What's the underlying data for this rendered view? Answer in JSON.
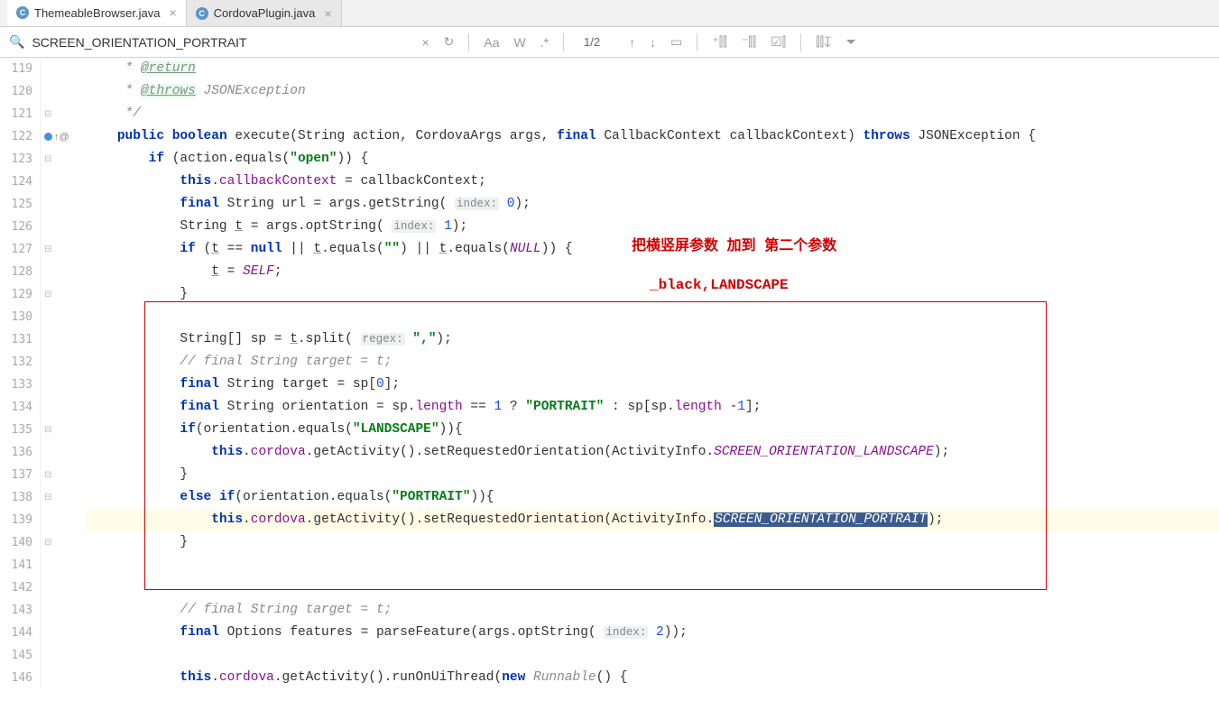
{
  "tabs": {
    "t0": {
      "label": "ThemeableBrowser.java"
    },
    "t1": {
      "label": "CordovaPlugin.java"
    }
  },
  "find": {
    "query": "SCREEN_ORIENTATION_PORTRAIT",
    "matchCount": "1/2",
    "caseLabel": "Aa",
    "wordLabel": "W",
    "regexLabel": ".*"
  },
  "annotations": {
    "a1": "把横竖屏参数 加到 第二个参数",
    "a2": "_black,LANDSCAPE"
  },
  "lines": {
    "n119": "119",
    "n120": "120",
    "n121": "121",
    "n122": "122",
    "n123": "123",
    "n124": "124",
    "n125": "125",
    "n126": "126",
    "n127": "127",
    "n128": "128",
    "n129": "129",
    "n130": "130",
    "n131": "131",
    "n132": "132",
    "n133": "133",
    "n134": "134",
    "n135": "135",
    "n136": "136",
    "n137": "137",
    "n138": "138",
    "n139": "139",
    "n140": "140",
    "n141": "141",
    "n142": "142",
    "n143": "143",
    "n144": "144",
    "n145": "145",
    "n146": "146"
  },
  "code": {
    "c119_pre": "     * ",
    "c119_tag": "@return",
    "c120_pre": "     * ",
    "c120_tag": "@throws",
    "c120_rest": " JSONException",
    "c121": "     */",
    "c122_1": "    ",
    "c122_k1": "public",
    "c122_2": " ",
    "c122_k2": "boolean",
    "c122_3": " execute(String action, CordovaArgs args, ",
    "c122_k3": "final",
    "c122_4": " CallbackContext callbackContext) ",
    "c122_k4": "throws",
    "c122_5": " JSONException {",
    "c123_1": "        ",
    "c123_k1": "if",
    "c123_2": " (action.equals(",
    "c123_s1": "\"open\"",
    "c123_3": ")) {",
    "c124_1": "            ",
    "c124_k1": "this",
    "c124_2": ".",
    "c124_f1": "callbackContext",
    "c124_3": " = callbackContext;",
    "c125_1": "            ",
    "c125_k1": "final",
    "c125_2": " String url = args.getString( ",
    "c125_h": "index:",
    "c125_3": " ",
    "c125_n": "0",
    "c125_4": ");",
    "c126_1": "            String ",
    "c126_u": "t",
    "c126_2": " = args.optString( ",
    "c126_h": "index:",
    "c126_3": " ",
    "c126_n": "1",
    "c126_4": ");",
    "c127_1": "            ",
    "c127_k1": "if",
    "c127_2": " (",
    "c127_u1": "t",
    "c127_3": " == ",
    "c127_k2": "null",
    "c127_4": " || ",
    "c127_u2": "t",
    "c127_5": ".equals(",
    "c127_s1": "\"\"",
    "c127_6": ") || ",
    "c127_u3": "t",
    "c127_7": ".equals(",
    "c127_c1": "NULL",
    "c127_8": ")) {",
    "c128_1": "                ",
    "c128_u": "t",
    "c128_2": " = ",
    "c128_c": "SELF",
    "c128_3": ";",
    "c129": "            }",
    "c130": "",
    "c131_1": "            String[] sp = ",
    "c131_u": "t",
    "c131_2": ".split( ",
    "c131_h": "regex:",
    "c131_3": " ",
    "c131_s": "\",\"",
    "c131_4": ");",
    "c132": "            // final String target = t;",
    "c133_1": "            ",
    "c133_k1": "final",
    "c133_2": " String target = sp[",
    "c133_n": "0",
    "c133_3": "];",
    "c134_1": "            ",
    "c134_k1": "final",
    "c134_2": " String orientation = sp.",
    "c134_f": "length",
    "c134_3": " == ",
    "c134_n1": "1",
    "c134_4": " ? ",
    "c134_s": "\"PORTRAIT\"",
    "c134_5": " : sp[sp.",
    "c134_f2": "length",
    "c134_6": " -",
    "c134_n2": "1",
    "c134_7": "];",
    "c135_1": "            ",
    "c135_k1": "if",
    "c135_2": "(orientation.equals(",
    "c135_s": "\"LANDSCAPE\"",
    "c135_3": ")){",
    "c136_1": "                ",
    "c136_k1": "this",
    "c136_2": ".",
    "c136_f": "cordova",
    "c136_3": ".getActivity().setRequestedOrientation(ActivityInfo.",
    "c136_c": "SCREEN_ORIENTATION_LANDSCAPE",
    "c136_4": ");",
    "c137": "            }",
    "c138_1": "            ",
    "c138_k1": "else",
    "c138_2": " ",
    "c138_k2": "if",
    "c138_3": "(orientation.equals(",
    "c138_s": "\"PORTRAIT\"",
    "c138_4": ")){",
    "c139_1": "                ",
    "c139_k1": "this",
    "c139_2": ".",
    "c139_f": "cordova",
    "c139_3": ".getActivity().setRequestedOrientation(ActivityInfo.",
    "c139_hl": "SCREEN_ORIENTATION_PORTRAIT",
    "c139_4": ");",
    "c140": "            }",
    "c141": "",
    "c142": "",
    "c143": "            // final String target = t;",
    "c144_1": "            ",
    "c144_k1": "final",
    "c144_2": " Options features = parseFeature(args.optString( ",
    "c144_h": "index:",
    "c144_3": " ",
    "c144_n": "2",
    "c144_4": "));",
    "c145": "",
    "c146_1": "            ",
    "c146_k1": "this",
    "c146_2": ".",
    "c146_f": "cordova",
    "c146_3": ".getActivity().runOnUiThread(",
    "c146_k2": "new",
    "c146_4": " ",
    "c146_cls": "Runnable",
    "c146_5": "() {"
  }
}
